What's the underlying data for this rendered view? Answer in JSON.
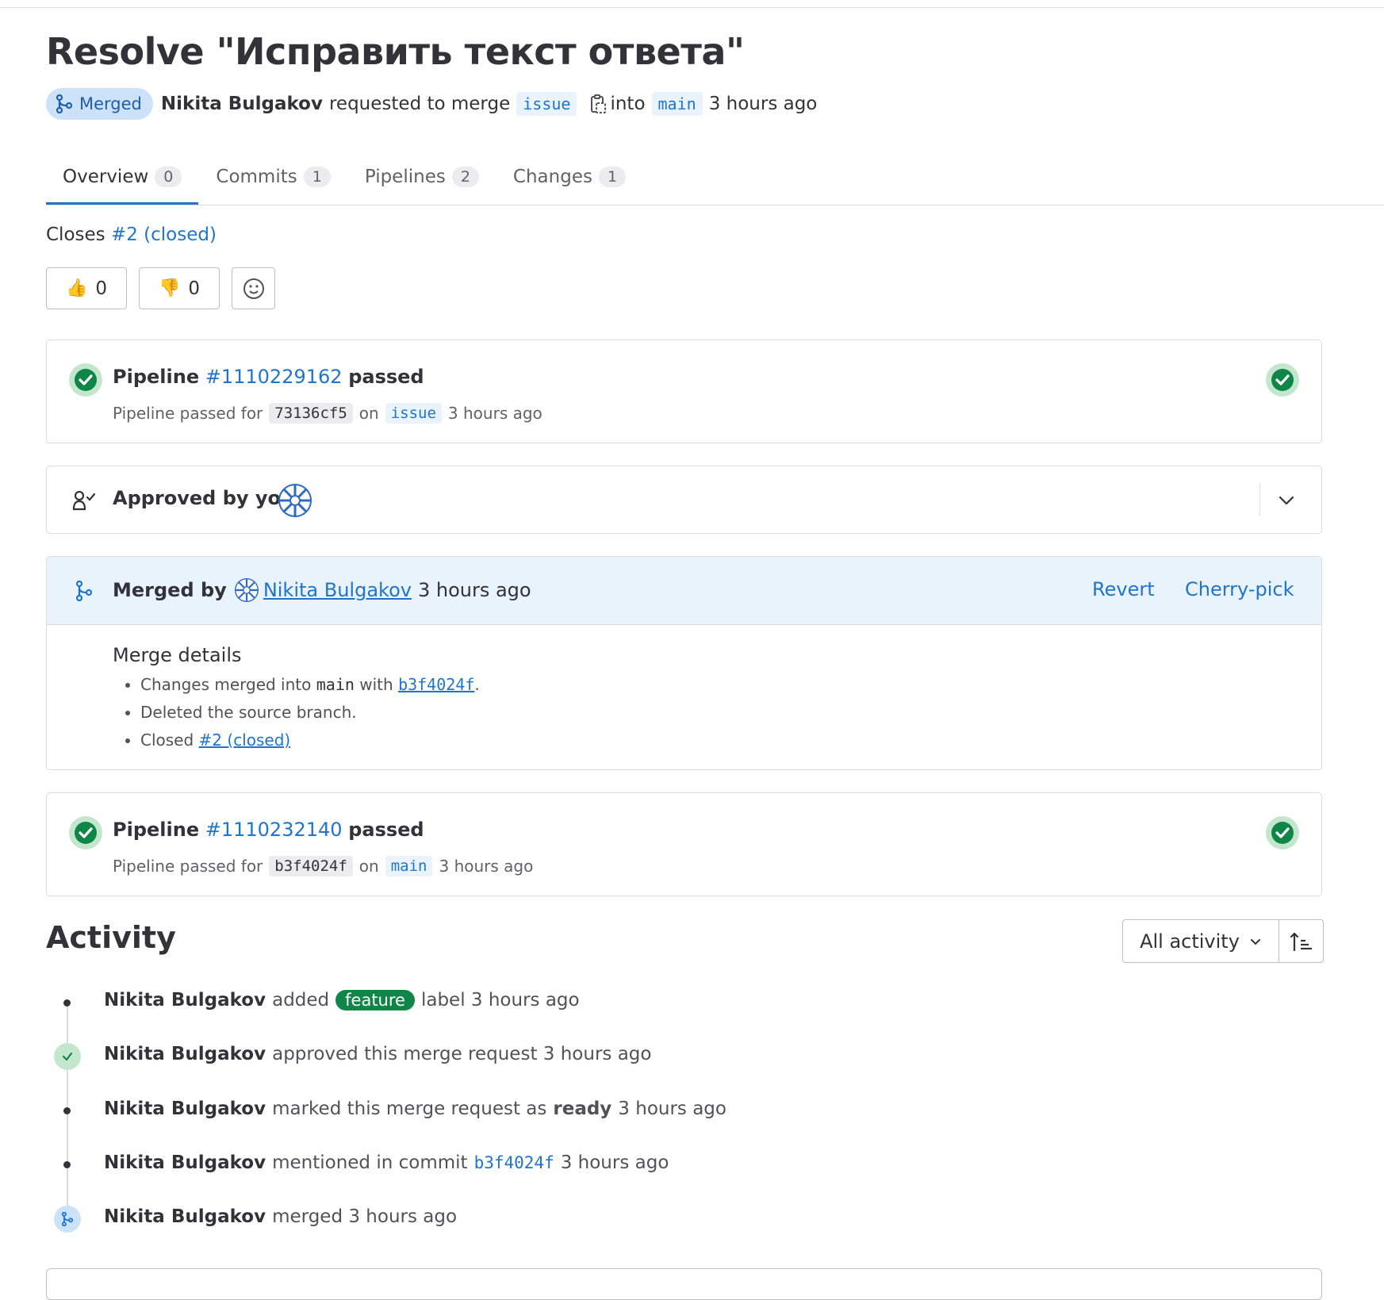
{
  "title": "Resolve \"Исправить текст ответа\"",
  "header": {
    "status_badge": "Merged",
    "author": "Nikita Bulgakov",
    "requested_text": "requested to merge",
    "source_branch": "issue",
    "into_text": "into",
    "target_branch": "main",
    "time": "3 hours ago"
  },
  "tabs": [
    {
      "label": "Overview",
      "count": "0"
    },
    {
      "label": "Commits",
      "count": "1"
    },
    {
      "label": "Pipelines",
      "count": "2"
    },
    {
      "label": "Changes",
      "count": "1"
    }
  ],
  "description": {
    "prefix": "Closes",
    "issue_link": "#2 (closed)"
  },
  "reactions": {
    "thumbs_up_count": "0",
    "thumbs_down_count": "0"
  },
  "pipeline1": {
    "title_prefix": "Pipeline",
    "id": "#1110229162",
    "status": "passed",
    "sub_prefix": "Pipeline passed for",
    "sha": "73136cf5",
    "on_text": "on",
    "branch": "issue",
    "time": "3 hours ago"
  },
  "approval": {
    "text": "Approved by you"
  },
  "merged": {
    "prefix": "Merged by",
    "user": "Nikita Bulgakov",
    "time": "3 hours ago",
    "revert_label": "Revert",
    "cherry_pick_label": "Cherry-pick",
    "details_title": "Merge details",
    "detail1_prefix": "Changes merged into",
    "detail1_branch": "main",
    "detail1_with": "with",
    "detail1_sha": "b3f4024f",
    "detail1_end": ".",
    "detail2": "Deleted the source branch.",
    "detail3_prefix": "Closed",
    "detail3_link": "#2 (closed)"
  },
  "pipeline2": {
    "title_prefix": "Pipeline",
    "id": "#1110232140",
    "status": "passed",
    "sub_prefix": "Pipeline passed for",
    "sha": "b3f4024f",
    "on_text": "on",
    "branch": "main",
    "time": "3 hours ago"
  },
  "activity": {
    "heading": "Activity",
    "filter_label": "All activity",
    "items": [
      {
        "user": "Nikita Bulgakov",
        "pre": "added",
        "label": "feature",
        "post": "label 3 hours ago"
      },
      {
        "user": "Nikita Bulgakov",
        "text": "approved this merge request 3 hours ago"
      },
      {
        "user": "Nikita Bulgakov",
        "pre": "marked this merge request as",
        "bold": "ready",
        "post": "3 hours ago"
      },
      {
        "user": "Nikita Bulgakov",
        "pre": "mentioned in commit",
        "sha": "b3f4024f",
        "post": "3 hours ago"
      },
      {
        "user": "Nikita Bulgakov",
        "text": "merged 3 hours ago"
      }
    ]
  },
  "colors": {
    "accent": "#1f75cb",
    "success": "#108548",
    "merged_badge_bg": "#cbe2f9",
    "merged_panel_bg": "#e9f3fc"
  }
}
